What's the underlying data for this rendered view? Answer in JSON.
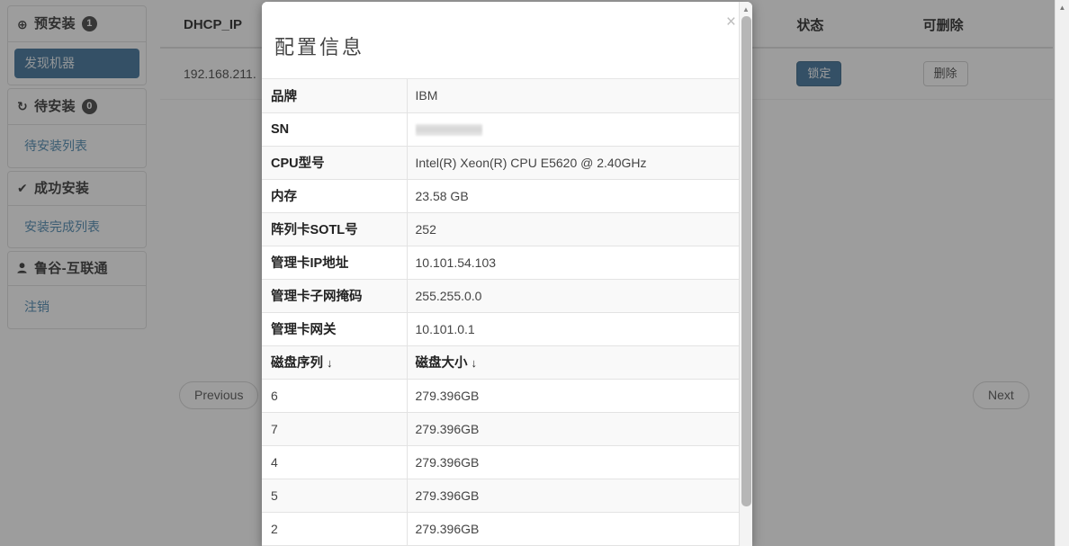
{
  "sidebar": {
    "sections": [
      {
        "icon": "up-arrow-circle-icon",
        "icon_glyph": "⊕",
        "title": "预安装",
        "badge": "1",
        "links": [
          {
            "label": "发现机器",
            "active": true,
            "name": "sidebar-item-discover-machines"
          }
        ]
      },
      {
        "icon": "refresh-icon",
        "icon_glyph": "↻",
        "title": "待安装",
        "badge": "0",
        "links": [
          {
            "label": "待安装列表",
            "active": false,
            "name": "sidebar-item-pending-list"
          }
        ]
      },
      {
        "icon": "checkmark-icon",
        "icon_glyph": "✔",
        "title": "成功安装",
        "badge": "",
        "links": [
          {
            "label": "安装完成列表",
            "active": false,
            "name": "sidebar-item-completed-list"
          }
        ]
      },
      {
        "icon": "user-icon",
        "icon_glyph": "👤",
        "title": "鲁谷-互联通",
        "badge": "",
        "links": [
          {
            "label": "注销",
            "active": false,
            "name": "sidebar-item-logout"
          }
        ]
      }
    ]
  },
  "background_table": {
    "columns": [
      {
        "key": "dhcp_ip",
        "label": "DHCP_IP"
      },
      {
        "key": "status",
        "label": "状态"
      },
      {
        "key": "deletable",
        "label": "可删除"
      }
    ],
    "rows": [
      {
        "dhcp_ip": "192.168.211.",
        "status_button": "锁定",
        "delete_button": "删除"
      }
    ]
  },
  "pager": {
    "previous_label": "Previous",
    "next_label": "Next"
  },
  "modal": {
    "title": "配置信息",
    "close_label": "×",
    "rows": [
      {
        "label": "品牌",
        "value": "IBM",
        "redacted": false
      },
      {
        "label": "SN",
        "value": "",
        "redacted": true
      },
      {
        "label": "CPU型号",
        "value": "Intel(R) Xeon(R) CPU E5620 @ 2.40GHz",
        "redacted": false
      },
      {
        "label": "内存",
        "value": "23.58 GB",
        "redacted": false
      },
      {
        "label": "阵列卡SOTL号",
        "value": "252",
        "redacted": false
      },
      {
        "label": "管理卡IP地址",
        "value": "10.101.54.103",
        "redacted": false
      },
      {
        "label": "管理卡子网掩码",
        "value": "255.255.0.0",
        "redacted": false
      },
      {
        "label": "管理卡网关",
        "value": "10.101.0.1",
        "redacted": false
      }
    ],
    "disk_header": {
      "serial_label": "磁盘序列",
      "size_label": "磁盘大小",
      "sort_arrow": "↓"
    },
    "disks": [
      {
        "serial": "6",
        "size": "279.396GB"
      },
      {
        "serial": "7",
        "size": "279.396GB"
      },
      {
        "serial": "4",
        "size": "279.396GB"
      },
      {
        "serial": "5",
        "size": "279.396GB"
      },
      {
        "serial": "2",
        "size": "279.396GB"
      }
    ]
  },
  "colors": {
    "accent_blue": "#2c6591",
    "link_blue": "#3a7ca8",
    "overlay": "#3c3c3c",
    "badge_dark": "#333333"
  }
}
